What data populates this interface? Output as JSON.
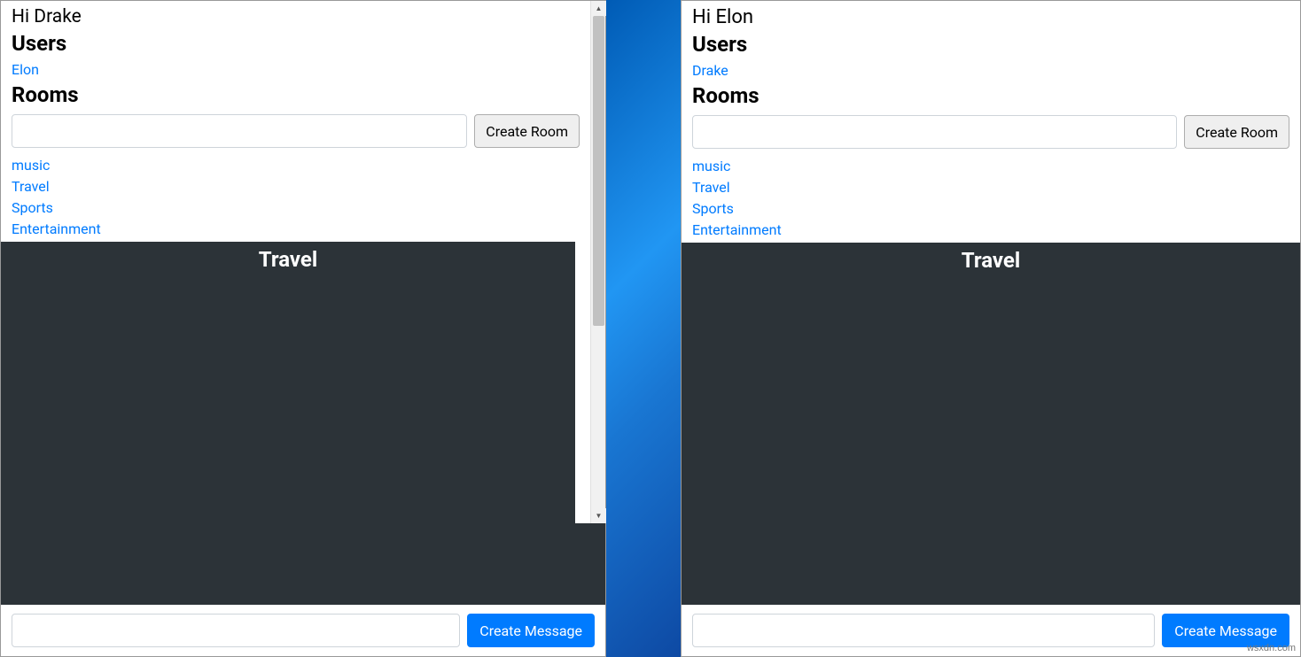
{
  "left": {
    "greeting": "Hi Drake",
    "users_title": "Users",
    "users": [
      "Elon"
    ],
    "rooms_title": "Rooms",
    "create_room_label": "Create Room",
    "rooms": [
      "music",
      "Travel",
      "Sports",
      "Entertainment"
    ],
    "active_room": "Travel",
    "create_message_label": "Create Message"
  },
  "right": {
    "greeting": "Hi Elon",
    "users_title": "Users",
    "users": [
      "Drake"
    ],
    "rooms_title": "Rooms",
    "create_room_label": "Create Room",
    "rooms": [
      "music",
      "Travel",
      "Sports",
      "Entertainment"
    ],
    "active_room": "Travel",
    "create_message_label": "Create Message"
  },
  "watermark": "wsxdn.com"
}
